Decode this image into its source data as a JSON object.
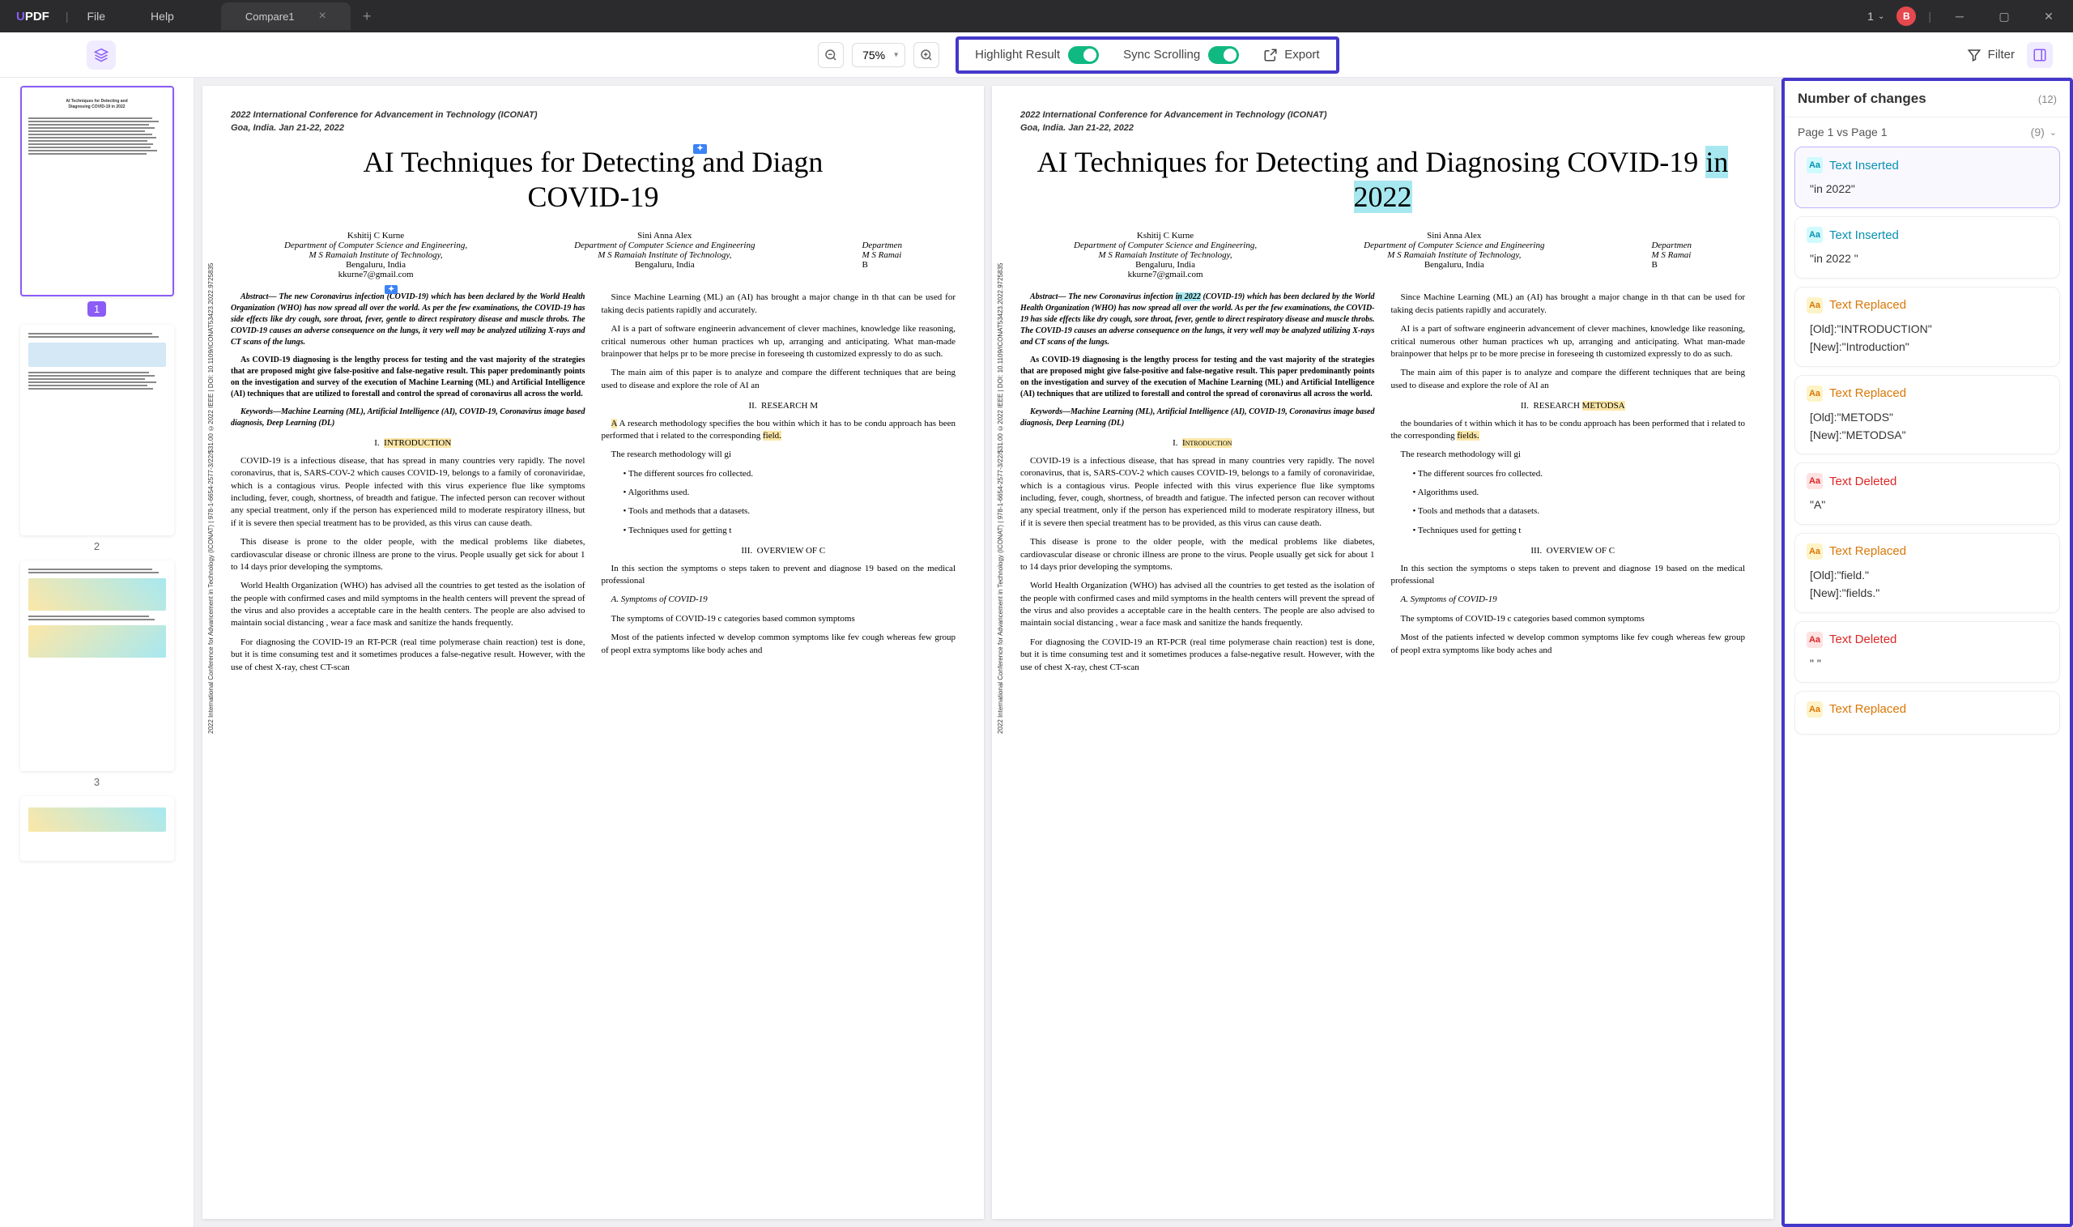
{
  "app": {
    "name_u": "U",
    "name_pdf": "PDF"
  },
  "menu": {
    "file": "File",
    "help": "Help"
  },
  "tab": {
    "name": "Compare1",
    "user_count": "1",
    "avatar": "B"
  },
  "toolbar": {
    "zoom": "75%",
    "highlight": "Highlight Result",
    "sync": "Sync Scrolling",
    "export": "Export",
    "filter": "Filter"
  },
  "thumbs": {
    "p1": "1",
    "p2": "2",
    "p3": "3"
  },
  "doc": {
    "conf": "2022 International Conference for Advancement in Technology (ICONAT)",
    "loc": "Goa, India. Jan 21-22, 2022",
    "title_left": "AI Techniques for Detecting and Diagn COVID-19",
    "title_right_pre": "AI Techniques for Detecting and Diagnosing COVID-19  ",
    "title_right_ins": "in 2022",
    "author1": "Kshitij C Kurne",
    "author1_dept": "Department of Computer Science and Engineering,",
    "author1_inst": "M S Ramaiah Institute of Technology,",
    "author1_city": "Bengaluru, India",
    "author1_email": "kkurne7@gmail.com",
    "author2": "Sini Anna Alex",
    "author2_dept": "Department of Computer Science and Engineering",
    "author2_inst": "M S Ramaiah Institute of Technology,",
    "author2_city": "Bengaluru, India",
    "author3_dept": "Departmen",
    "author3_inst": "M S Ramai",
    "author3_city": "B",
    "abstract_left": "Abstract— The new Coronavirus infection (COVID-19) which has been declared by the World Health Organization (WHO) has now spread all over the world. As per the few examinations, the COVID-19 has side effects like dry cough, sore throat, fever, gentle to direct respiratory disease and muscle throbs. The COVID-19 causes an adverse consequence on the lungs, it very well may be analyzed utilizing X-rays and CT scans of the lungs.",
    "abstract_right_pre": "Abstract— The new Coronavirus infection ",
    "abstract_right_ins": "in 2022",
    "abstract_right_post": " (COVID-19) which has been declared by the World Health Organization (WHO) has now spread all over the world. As per the few examinations, the COVID-19 has side effects like dry cough, sore throat, fever, gentle to direct respiratory disease and muscle throbs. The COVID-19 causes an adverse consequence on the lungs, it very well may be analyzed utilizing X-rays and CT scans of the lungs.",
    "abs2": "As COVID-19 diagnosing is the lengthy process for testing and the vast majority of the strategies that are proposed might give false-positive and false-negative result. This paper predominantly points on the investigation and survey of the execution of Machine Learning (ML) and Artificial Intelligence (AI) techniques that are utilized to forestall and control the spread of coronavirus all across the world.",
    "keywords": "Keywords—Machine Learning (ML), Artificial Intelligence (AI), COVID-19, Coronavirus image based diagnosis, Deep Learning (DL)",
    "sec_intro_num": "I.",
    "sec_intro_left": "INTRODUCTION",
    "sec_intro_right": "Introduction",
    "intro_text": " COVID-19 is a infectious disease, that has spread in many countries very rapidly. The novel coronavirus, that is, SARS-COV-2 which causes COVID-19, belongs to a family of coronaviridae, which is a contagious virus. People infected with this virus experience flue like symptoms including, fever, cough, shortness, of breadth and fatigue. The infected person can recover without any special treatment, only if the person has experienced mild to moderate respiratory illness, but if it is severe then special treatment has to be provided, as this virus can cause death.",
    "intro_text2": "This disease is prone to the older people, with the medical problems like diabetes, cardiovascular disease or chronic illness are prone to the virus. People usually get sick for about 1 to 14 days prior developing the symptoms.",
    "intro_text3": "World Health Organization (WHO) has advised all the countries to get tested as the isolation of the people with confirmed cases and mild symptoms in the health centers will prevent the spread of the virus and also provides a acceptable care in the health centers. The people are also advised to maintain social distancing , wear a face mask and sanitize the hands frequently.",
    "intro_text4": "For diagnosing the COVID-19 an RT-PCR (real time polymerase chain reaction) test is done, but it is time consuming test and it sometimes produces a false-negative result. However, with the use of chest X-ray, chest CT-scan",
    "col2_1": "Since Machine Learning (ML) an (AI) has brought a major change in th that can be used for taking decis patients rapidly and accurately.",
    "col2_2": "AI is a part of software engineerin advancement of clever machines, knowledge like reasoning, critical numerous other human practices wh up, arranging and anticipating. What man-made brainpower that helps pr to be more precise in foreseeing th customized expressly to do as such.",
    "col2_3": "The main aim of this paper is to analyze and compare the different techniques that are being used to disease and explore the role of AI an",
    "sec_research_num": "II.",
    "sec_research_left": "RESEARCH M",
    "sec_research_right": "RESEARCH",
    "sec_research_right_hl": "METODSA",
    "research_text_left_pre": "A research methodology specifies the bou within which it has to be condu approach has been performed that i related to the corresponding ",
    "research_text_left_hl": "field.",
    "research_text_right_pre": "the boundaries of t within which it has to be condu approach has been performed that i related to the corresponding ",
    "research_text_right_hl": "fields.",
    "research_text2": "The research methodology will gi",
    "bullet1": "The different sources fro collected.",
    "bullet2": "Algorithms used.",
    "bullet3": "Tools and methods that a datasets.",
    "bullet4": "Techniques used for getting t",
    "sec_overview_num": "III.",
    "sec_overview": "OVERVIEW OF C",
    "overview_text": "In this section the symptoms o steps taken to prevent and diagnose 19 based on the medical professional",
    "sec_symptoms": "A. Symptoms of COVID-19",
    "symptoms_text": "The symptoms of COVID-19 c categories based common symptoms",
    "symptoms_text2": "Most of the patients infected w develop common symptoms like fev cough whereas few group of peopl extra symptoms like body aches and",
    "sidenote": "2022 International Conference for Advancement in Technology (ICONAT) | 978-1-6654-2577-3/22/$31.00 ©2022 IEEE | DOI: 10.1109/ICONAT53423.2022.9725835"
  },
  "changes": {
    "title": "Number of changes",
    "total": "(12)",
    "page_compare": "Page 1 vs Page 1",
    "page_count": "(9)",
    "items": [
      {
        "type": "inserted",
        "label": "Text Inserted",
        "detail": "\"in 2022\""
      },
      {
        "type": "inserted",
        "label": "Text Inserted",
        "detail": "\"in 2022 \""
      },
      {
        "type": "replaced",
        "label": "Text Replaced",
        "old": "[Old]:\"INTRODUCTION\"",
        "new": "[New]:\"Introduction\""
      },
      {
        "type": "replaced",
        "label": "Text Replaced",
        "old": "[Old]:\"METODS\"",
        "new": "[New]:\"METODSA\""
      },
      {
        "type": "deleted",
        "label": "Text Deleted",
        "detail": "\"A\""
      },
      {
        "type": "replaced",
        "label": "Text Replaced",
        "old": "[Old]:\"field.\"",
        "new": "[New]:\"fields.\""
      },
      {
        "type": "deleted",
        "label": "Text Deleted",
        "detail": "\" \""
      },
      {
        "type": "replaced",
        "label": "Text Replaced",
        "old": "",
        "new": ""
      }
    ]
  }
}
